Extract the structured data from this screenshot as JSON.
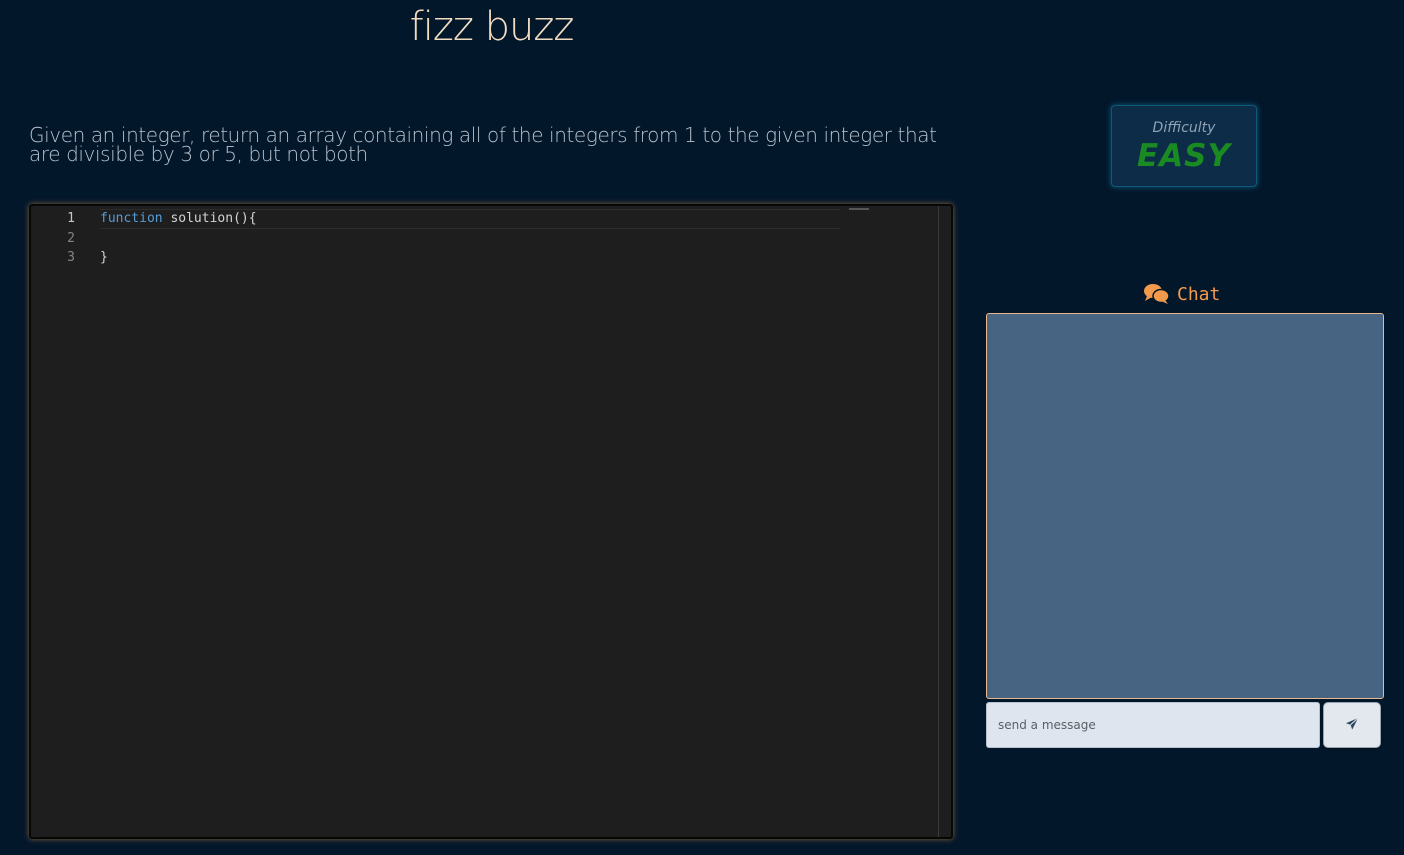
{
  "problem": {
    "title": "fizz buzz",
    "prompt": "Given an integer, return an array containing all of the integers from 1 to the given integer that are divisible by 3 or 5, but not both"
  },
  "difficulty": {
    "label": "Difficulty",
    "value": "EASY",
    "value_color": "#1a8a22"
  },
  "editor": {
    "lines": [
      {
        "number": "1",
        "keyword": "function",
        "rest": " solution(){"
      },
      {
        "number": "2",
        "keyword": "",
        "rest": ""
      },
      {
        "number": "3",
        "keyword": "",
        "rest": "}"
      }
    ]
  },
  "chat": {
    "title": "Chat",
    "icon": "comments-icon",
    "input_placeholder": "send a message",
    "send_icon": "paper-plane-icon",
    "accent_color": "#f39a4c"
  }
}
